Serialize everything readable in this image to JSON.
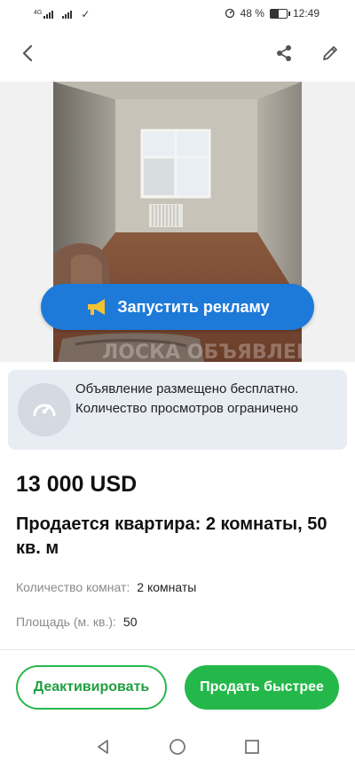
{
  "status_bar": {
    "network_label": "4G",
    "battery_text": "48 %",
    "battery_level": 0.48,
    "time": "12:49"
  },
  "app_bar": {
    "back_icon": "back-arrow-icon",
    "share_icon": "share-icon",
    "edit_icon": "pencil-icon"
  },
  "photo": {
    "watermark": "ЛОСКА ОБЪЯВЛЕНИЙ"
  },
  "promo": {
    "label": "Запустить рекламу",
    "icon": "megaphone-icon",
    "color": "#1e7ad9"
  },
  "notice": {
    "text": "Объявление размещено бесплатно. Количество просмотров ограничено",
    "icon": "speedometer-icon"
  },
  "listing": {
    "price": "13 000 USD",
    "title": "Продается квартира: 2 комнаты, 50 кв. м",
    "params": [
      {
        "label": "Количество комнат:",
        "value": "2 комнаты"
      },
      {
        "label": "Площадь (м. кв.):",
        "value": "50"
      }
    ]
  },
  "actions": {
    "deactivate_label": "Деактивировать",
    "sell_faster_label": "Продать быстрее",
    "accent_color": "#24b84a"
  },
  "nav_bar": {
    "back": "triangle-back-icon",
    "home": "circle-home-icon",
    "recents": "square-recents-icon"
  }
}
